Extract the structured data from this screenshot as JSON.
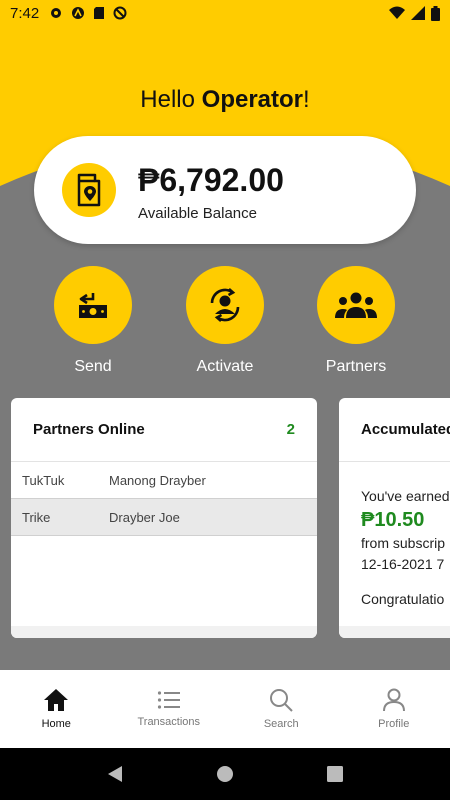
{
  "status_bar": {
    "time": "7:42"
  },
  "greeting": {
    "prefix": "Hello ",
    "name": "Operator",
    "suffix": "!"
  },
  "balance": {
    "amount": "₱6,792.00",
    "label": "Available Balance",
    "icon": "wallet-location-icon"
  },
  "actions": [
    {
      "label": "Send",
      "icon": "send-money-icon"
    },
    {
      "label": "Activate",
      "icon": "activate-user-icon"
    },
    {
      "label": "Partners",
      "icon": "partners-group-icon"
    }
  ],
  "partners_card": {
    "title": "Partners Online",
    "count": "2",
    "rows": [
      {
        "type": "TukTuk",
        "name": "Manong Drayber"
      },
      {
        "type": "Trike",
        "name": "Drayber Joe"
      }
    ]
  },
  "accumulated_card": {
    "title": "Accumulated",
    "line1": "You've earned",
    "amount": "₱10.50",
    "line2": "from subscrip",
    "date": "12-16-2021 7",
    "line3": "Congratulatio"
  },
  "bottom_nav": [
    {
      "label": "Home",
      "icon": "home-icon",
      "active": true
    },
    {
      "label": "Transactions",
      "icon": "list-icon",
      "active": false
    },
    {
      "label": "Search",
      "icon": "search-icon",
      "active": false
    },
    {
      "label": "Profile",
      "icon": "person-icon",
      "active": false
    }
  ],
  "colors": {
    "accent": "#ffcc00",
    "background": "#7a7a7a",
    "success": "#1f8a1f"
  }
}
